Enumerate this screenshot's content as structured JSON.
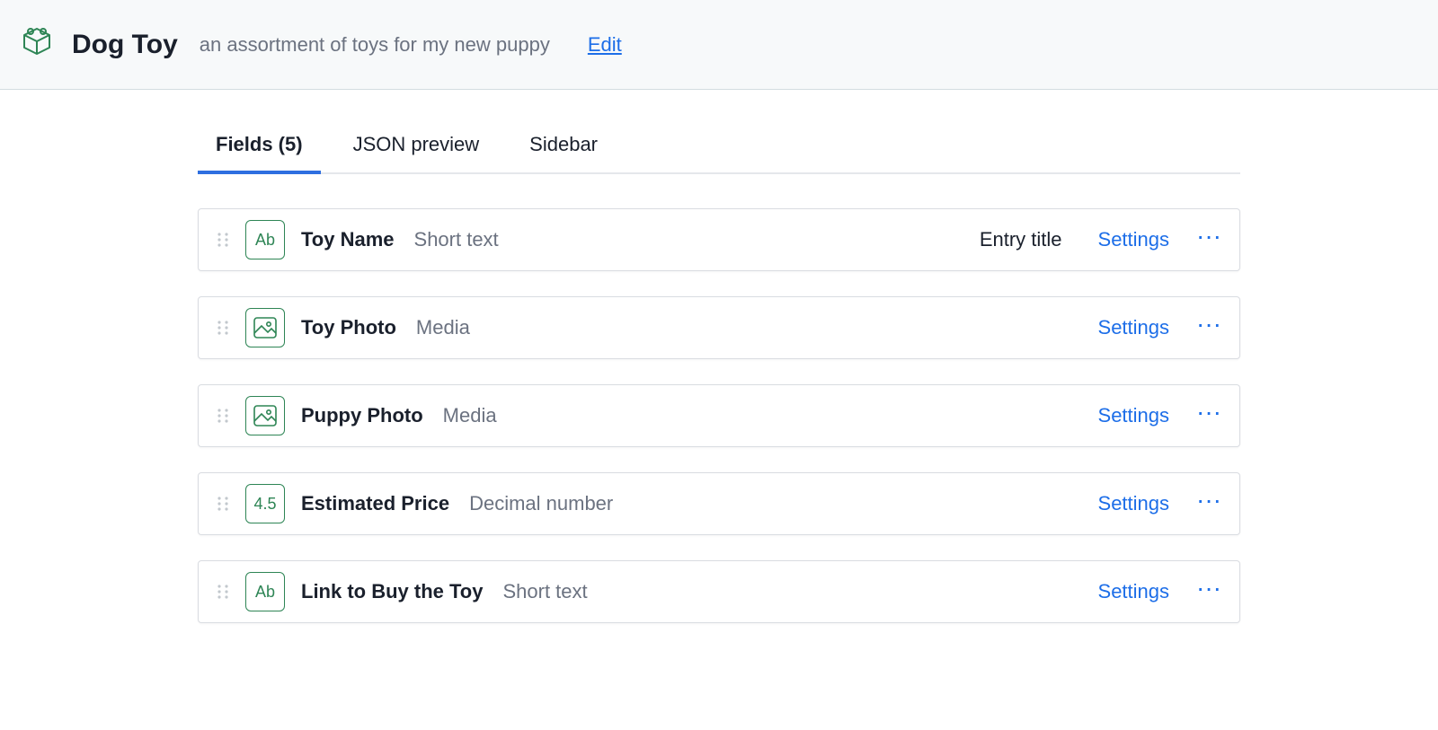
{
  "header": {
    "title": "Dog Toy",
    "description": "an assortment of toys for my new puppy",
    "edit_label": "Edit"
  },
  "tabs": {
    "fields": "Fields (5)",
    "json_preview": "JSON preview",
    "sidebar": "Sidebar"
  },
  "actions": {
    "settings": "Settings"
  },
  "badges": {
    "entry_title": "Entry title"
  },
  "icon_labels": {
    "text": "Ab",
    "decimal": "4.5"
  },
  "fields": [
    {
      "name": "Toy Name",
      "type": "Short text",
      "icon": "text",
      "entry_title": true
    },
    {
      "name": "Toy Photo",
      "type": "Media",
      "icon": "media",
      "entry_title": false
    },
    {
      "name": "Puppy Photo",
      "type": "Media",
      "icon": "media",
      "entry_title": false
    },
    {
      "name": "Estimated Price",
      "type": "Decimal number",
      "icon": "decimal",
      "entry_title": false
    },
    {
      "name": "Link to Buy the Toy",
      "type": "Short text",
      "icon": "text",
      "entry_title": false
    }
  ]
}
